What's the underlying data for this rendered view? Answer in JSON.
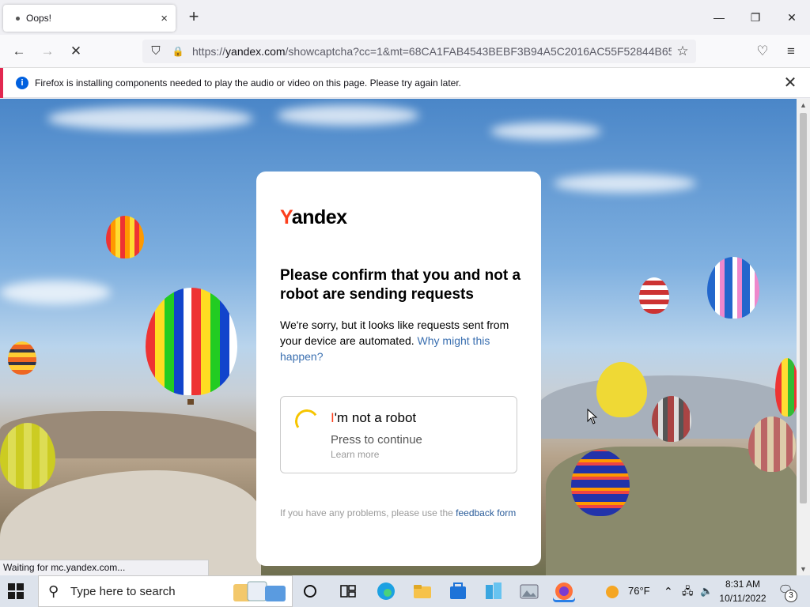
{
  "browser": {
    "tab_title": "Oops!",
    "tab_close": "×",
    "new_tab": "+",
    "url_prefix": "https://",
    "url_host": "yandex.com",
    "url_rest": "/showcaptcha?cc=1&mt=68CA1FAB4543BEBF3B94A5C2016AC55F52844B65C",
    "window_controls": {
      "minimize": "—",
      "maximize": "❐",
      "close": "✕"
    },
    "nav": {
      "back": "←",
      "forward": "→",
      "stop": "✕",
      "menu": "≡",
      "bookmark": "☆",
      "pocket": "♡",
      "shield": "⛉",
      "lock": "🔒"
    }
  },
  "notification": {
    "icon": "i",
    "message": "Firefox is installing components needed to play the audio or video on this page. Please try again later.",
    "close": "✕"
  },
  "captcha": {
    "logo_y": "Y",
    "logo_rest": "andex",
    "heading": "Please confirm that you and not a robot are sending requests",
    "description": "We're sorry, but it looks like requests sent from your device are automated.",
    "why_link": "Why might this happen?",
    "robot_i": "I",
    "robot_rest": "'m not a robot",
    "press_to_continue": "Press to continue",
    "learn_more": "Learn more",
    "footer_text": "If you have any problems, please use the",
    "feedback_link": "feedback form"
  },
  "status_bar": "Waiting for mc.yandex.com...",
  "taskbar": {
    "search_placeholder": "Type here to search",
    "weather": "76°F",
    "time": "8:31 AM",
    "date": "10/11/2022",
    "notification_count": "3",
    "icons": [
      "task-view-icon",
      "widgets-icon",
      "edge-icon",
      "file-explorer-icon",
      "microsoft-store-icon",
      "azure-data-studio-icon",
      "photos-icon",
      "firefox-icon"
    ]
  },
  "colors": {
    "yandex_red": "#fc3f1d",
    "spinner_yellow": "#f6c500",
    "link_blue": "#3a6fb0",
    "notif_accent": "#e22850"
  }
}
